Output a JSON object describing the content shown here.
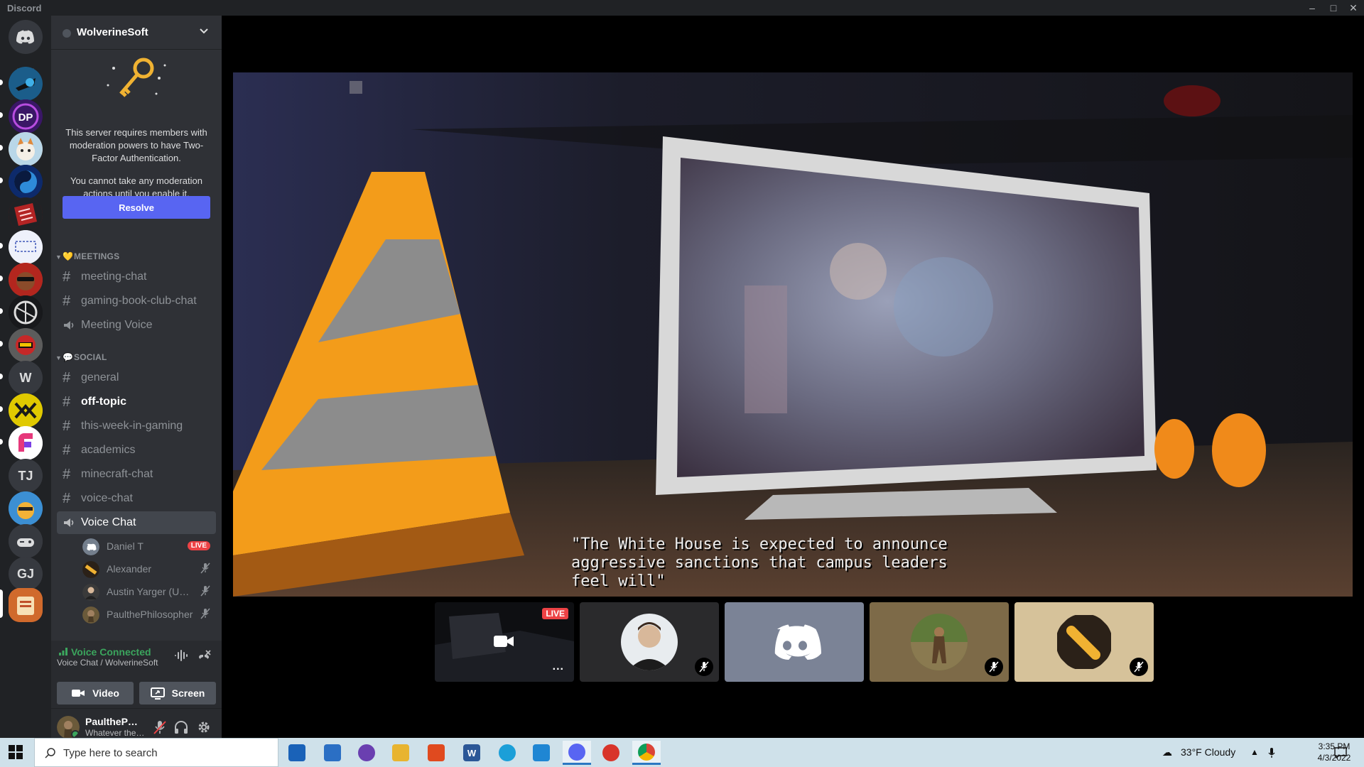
{
  "window": {
    "title": "Discord"
  },
  "rail": {
    "servers": [
      {
        "name": "discord-home",
        "kind": "home"
      },
      {
        "name": "server-1",
        "initials": ""
      },
      {
        "name": "server-dp",
        "initials": "DP"
      },
      {
        "name": "server-3",
        "initials": ""
      },
      {
        "name": "server-4",
        "initials": ""
      },
      {
        "name": "server-5",
        "initials": ""
      },
      {
        "name": "server-6",
        "initials": ""
      },
      {
        "name": "server-7",
        "initials": ""
      },
      {
        "name": "server-8",
        "initials": ""
      },
      {
        "name": "server-9",
        "initials": ""
      },
      {
        "name": "server-w",
        "initials": "W"
      },
      {
        "name": "server-11",
        "initials": ""
      },
      {
        "name": "server-12",
        "initials": ""
      },
      {
        "name": "server-tj",
        "initials": "TJ"
      },
      {
        "name": "server-14",
        "initials": ""
      },
      {
        "name": "server-15",
        "initials": ""
      },
      {
        "name": "server-gj",
        "initials": "GJ"
      },
      {
        "name": "server-wolverinesoft",
        "initials": ""
      }
    ]
  },
  "server": {
    "name": "WolverineSoft",
    "notice": {
      "text1": "This server requires members with moderation powers to have Two-Factor Authentication.",
      "text2": "You cannot take any moderation actions until you enable it.",
      "resolve_label": "Resolve"
    },
    "categories": [
      {
        "label": "MEETINGS",
        "emoji": "💛"
      },
      {
        "label": "SOCIAL",
        "emoji": "💬"
      }
    ],
    "channels": [
      {
        "name": "meeting-chat",
        "type": "text"
      },
      {
        "name": "gaming-book-club-chat",
        "type": "text"
      },
      {
        "name": "Meeting Voice",
        "type": "voice"
      },
      {
        "name": "general",
        "type": "text"
      },
      {
        "name": "off-topic",
        "type": "text",
        "unread": true
      },
      {
        "name": "this-week-in-gaming",
        "type": "text"
      },
      {
        "name": "academics",
        "type": "text"
      },
      {
        "name": "minecraft-chat",
        "type": "text"
      },
      {
        "name": "voice-chat",
        "type": "text"
      },
      {
        "name": "Voice Chat",
        "type": "voice",
        "active": true
      }
    ],
    "voice_users": [
      {
        "name": "Daniel T",
        "live": "LIVE"
      },
      {
        "name": "Alexander",
        "muted": true
      },
      {
        "name": "Austin Yarger (UMich)",
        "muted": true
      },
      {
        "name": "PaulthePhilosopher",
        "muted": true
      }
    ]
  },
  "voice_panel": {
    "status": "Voice Connected",
    "channel": "Voice Chat / WolverineSoft",
    "video_label": "Video",
    "screen_label": "Screen"
  },
  "user_panel": {
    "name": "PaulthePhilosopher",
    "status": "Whatever the weather"
  },
  "stream": {
    "subtitle": "\"The White House is expected to announce\naggressive sanctions that campus leaders\nfeel will\""
  },
  "tiles": {
    "live_label": "LIVE",
    "more_label": "..."
  },
  "taskbar": {
    "search_placeholder": "Type here to search",
    "weather": "33°F  Cloudy",
    "time": "3:35 PM",
    "date": "4/3/2022"
  },
  "colors": {
    "blurple": "#5865f2",
    "live_red": "#ed4245",
    "connected_green": "#3ba55d"
  }
}
